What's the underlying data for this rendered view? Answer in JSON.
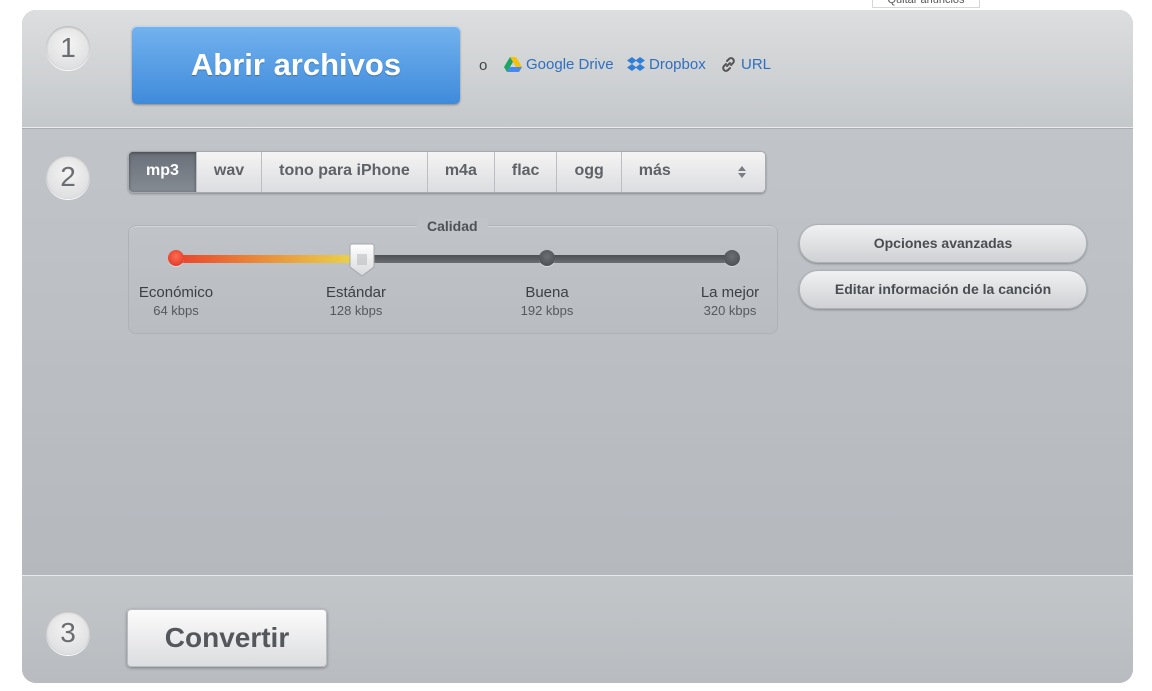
{
  "ads": {
    "label": "Quitar anuncios"
  },
  "steps": {
    "one": "1",
    "two": "2",
    "three": "3"
  },
  "open": {
    "button_label": "Abrir archivos",
    "or": "o",
    "sources": [
      {
        "label": "Google Drive",
        "icon": "google-drive-icon"
      },
      {
        "label": "Dropbox",
        "icon": "dropbox-icon"
      },
      {
        "label": "URL",
        "icon": "link-icon"
      }
    ]
  },
  "formats": {
    "selected": "mp3",
    "items": [
      "mp3",
      "wav",
      "tono para iPhone",
      "m4a",
      "flac",
      "ogg",
      "más"
    ]
  },
  "quality": {
    "title": "Calidad",
    "selected_index": 1,
    "levels": [
      {
        "label": "Económico",
        "bitrate": "64 kbps"
      },
      {
        "label": "Estándar",
        "bitrate": "128 kbps"
      },
      {
        "label": "Buena",
        "bitrate": "192 kbps"
      },
      {
        "label": "La mejor",
        "bitrate": "320 kbps"
      }
    ]
  },
  "options": {
    "advanced": "Opciones avanzadas",
    "edit_info": "Editar información de la canción"
  },
  "convert": {
    "button_label": "Convertir"
  },
  "colors": {
    "accent_blue": "#4a93e0",
    "link_blue": "#2f6fc0",
    "panel_gray": "#b9bdc2",
    "active_format": "#6f757d"
  }
}
